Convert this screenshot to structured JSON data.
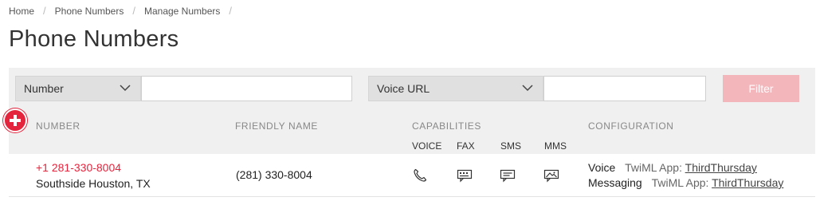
{
  "breadcrumb": [
    {
      "label": "Home"
    },
    {
      "label": "Phone Numbers"
    },
    {
      "label": "Manage Numbers"
    }
  ],
  "breadcrumb_sep": "/",
  "page_title": "Phone Numbers",
  "filter": {
    "field1_selected": "Number",
    "field1_value": "",
    "field2_selected": "Voice URL",
    "field2_value": "",
    "button_label": "Filter"
  },
  "table": {
    "headers": {
      "number": "NUMBER",
      "friendly_name": "FRIENDLY NAME",
      "capabilities": "CAPABILITIES",
      "configuration": "CONFIGURATION"
    },
    "capability_headers": [
      "VOICE",
      "FAX",
      "SMS",
      "MMS"
    ],
    "rows": [
      {
        "number": "+1 281-330-8004",
        "location": "Southside Houston, TX",
        "friendly_name": "(281) 330-8004",
        "capabilities": [
          "phone-icon",
          "fax-icon",
          "sms-icon",
          "mms-icon"
        ],
        "config": {
          "voice_label": "Voice",
          "voice_app_prefix": "TwiML App:",
          "voice_app": "ThirdThursday",
          "messaging_label": "Messaging",
          "messaging_app_prefix": "TwiML App:",
          "messaging_app": "ThirdThursday"
        }
      }
    ]
  },
  "colors": {
    "accent": "#e4243c",
    "filter_button": "#f2b6bb",
    "filter_bar_bg": "#f0f0f0"
  },
  "icons": {
    "add": "plus-icon",
    "dropdown": "chevron-down-icon"
  }
}
